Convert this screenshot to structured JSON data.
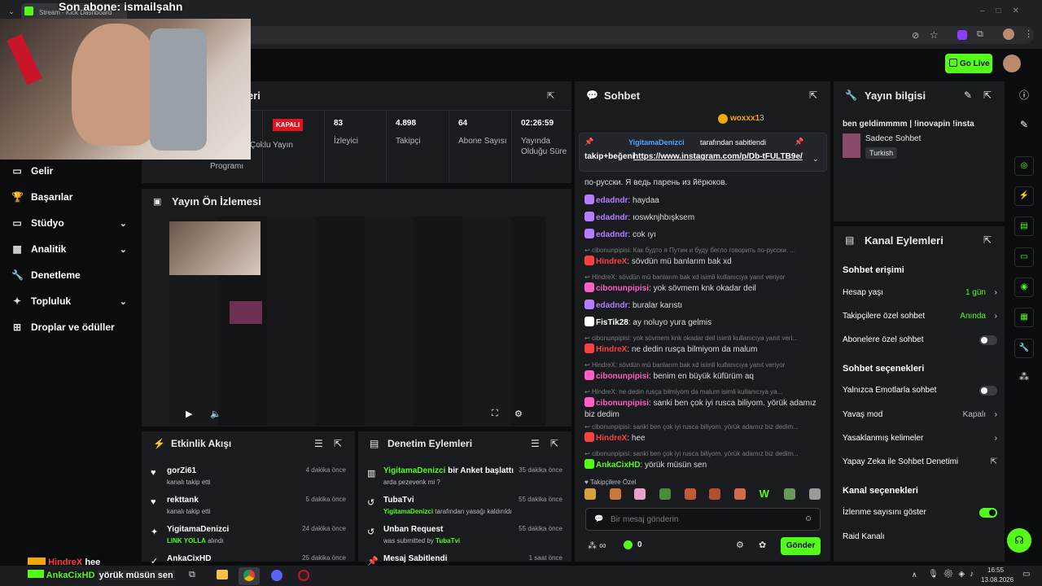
{
  "overlay": {
    "subscriber_banner": "Son abone: ismailşahn"
  },
  "browser": {
    "tab_title": "Stream - Kick Dashboard"
  },
  "header": {
    "go_live_label": "Go Live"
  },
  "nav": {
    "items": [
      {
        "label": "Gelir",
        "icon": "money-icon"
      },
      {
        "label": "Başarılar",
        "icon": "trophy-icon"
      },
      {
        "label": "Stüdyo",
        "icon": "studio-icon",
        "expandable": true
      },
      {
        "label": "Analitik",
        "icon": "chart-icon",
        "expandable": true
      },
      {
        "label": "Denetleme",
        "icon": "wrench-icon"
      },
      {
        "label": "Topluluk",
        "icon": "community-icon",
        "expandable": true
      },
      {
        "label": "Droplar ve ödüller",
        "icon": "gift-icon"
      }
    ]
  },
  "stats_panel": {
    "title_partial": "eri",
    "program_label": "Programı",
    "status_badge": "KAPALI",
    "multistream_label": "Çoklu Yayın",
    "stats": [
      {
        "value": "83",
        "label": "İzleyici"
      },
      {
        "value": "4.898",
        "label": "Takipçi"
      },
      {
        "value": "64",
        "label": "Abone Sayısı"
      },
      {
        "value": "02:26:59",
        "label": "Yayında Olduğu Süre"
      }
    ]
  },
  "preview": {
    "title": "Yayın Ön İzlemesi"
  },
  "activity_feed": {
    "title": "Etkinlik Akışı",
    "items": [
      {
        "name": "gorZi61",
        "detail": "kanalı takip etti",
        "time": "4 dakika önce"
      },
      {
        "name": "rekttank",
        "detail": "kanalı takip etti",
        "time": "5 dakika önce"
      },
      {
        "name": "YigitamaDenizci",
        "detail_highlight": "LINK YOLLA",
        "detail": "alındı",
        "time": "24 dakika önce"
      },
      {
        "name": "AnkaCixHD",
        "detail": "",
        "time": "25 dakika önce"
      }
    ]
  },
  "mod_actions": {
    "title": "Denetim Eylemleri",
    "items": [
      {
        "name": "YigitamaDenizci",
        "action": "bir Anket başlattı",
        "detail": "arda pezevenk mi ?",
        "time": "35 dakika önce"
      },
      {
        "name": "TubaTvi",
        "detail_user": "YigitamaDenizci",
        "detail": "tarafından yasağı kaldırıldı",
        "time": "55 dakika önce"
      },
      {
        "name": "Unban Request",
        "detail": "was submitted by",
        "detail_user": "TubaTvi",
        "time": "55 dakika önce"
      },
      {
        "name": "Mesaj Sabitlendi",
        "detail": "",
        "time": "1 saat önce"
      }
    ]
  },
  "chat": {
    "title": "Sohbet",
    "top_gifter": {
      "name": "woxxx1",
      "count": "3"
    },
    "pinned": {
      "by": "YigitamaDenizci",
      "by_suffix": "tarafından sabitlendi",
      "text_prefix": "takip+beğeni",
      "link": "https://www.instagram.com/p/Db-tFULTB9e/"
    },
    "overflow_text": "по-русски. Я ведь парень из йёрюков.",
    "messages": [
      {
        "user": "edadndr",
        "text": "haydaa",
        "color": "#b67dff"
      },
      {
        "user": "edadndr",
        "text": "ıoswknjhbışksem",
        "color": "#b67dff"
      },
      {
        "user": "edadndr",
        "text": "cok ıyı",
        "color": "#b67dff"
      },
      {
        "reply": "cibonunpipisi: Как будто я Путин и буду бегло говорить по-русски. ..."
      },
      {
        "user": "HindreX",
        "text": "sövdün mü banlarım bak xd",
        "color": "#ff4040"
      },
      {
        "reply": "HindreX: sövdün mü banlarım bak xd isimli kullanıcıya yanıt veriyor"
      },
      {
        "user": "cibonunpipisi",
        "text": "yok sövmem knk okadar deil",
        "color": "#ff5ec4"
      },
      {
        "user": "edadndr",
        "text": "buralar karıstı",
        "color": "#b67dff"
      },
      {
        "user": "FisTik28",
        "text": "ay noluyo yura gelmis",
        "color": "#ffffff"
      },
      {
        "reply": "cibonunpipisi: yok sövmem knk okadar deil isimli kullanıcıya yanıt veri..."
      },
      {
        "user": "HindreX",
        "text": "ne dedin rusça bilmiyom da malum",
        "color": "#ff4040"
      },
      {
        "reply": "HindreX: sövdün mü banlarım bak xd isimli kullanıcıya yanıt veriyor"
      },
      {
        "user": "cibonunpipisi",
        "text": "benim en büyük küfürüm aq",
        "color": "#ff5ec4"
      },
      {
        "reply": "HindreX: ne dedin rusça bilmiyom da malum isimli kullanıcıya ya..."
      },
      {
        "user": "cibonunpipisi",
        "text": "sanki ben çok iyi rusca biliyom. yörük adamız biz dedim",
        "color": "#ff5ec4"
      },
      {
        "reply": "cibonunpipisi: sanki ben çok iyi rusca biliyom. yörük adamız biz dedim..."
      },
      {
        "user": "HindreX",
        "text": "hee",
        "color": "#ff4040"
      },
      {
        "reply": "cibonunpipisi: sanki ben çok iyi rusca biliyom. yörük adamız biz dedim..."
      },
      {
        "user": "AnkaCixHD",
        "text": "yörük müsün sen",
        "color": "#53fc18"
      }
    ],
    "emote_label": "Takipçilere Özel",
    "input_placeholder": "Bir mesaj gönderin",
    "viewer_count": "∞",
    "points": "0",
    "send_label": "Gönder"
  },
  "stream_info": {
    "title": "Yayın bilgisi",
    "stream_title": "ben geldimmmm | !inovapin !insta",
    "category": "Sadece Sohbet",
    "language_tag": "Turkish"
  },
  "channel_actions": {
    "title": "Kanal Eylemleri",
    "chat_access_heading": "Sohbet erişimi",
    "account_age_label": "Hesap yaşı",
    "account_age_value": "1 gün",
    "followers_only_label": "Takipçilere özel sohbet",
    "followers_only_value": "Anında",
    "subs_only_label": "Abonelere özel sohbet",
    "chat_options_heading": "Sohbet seçenekleri",
    "emote_only_label": "Yalnızca Emotlarla sohbet",
    "slow_mode_label": "Yavaş mod",
    "slow_mode_value": "Kapalı",
    "banned_words_label": "Yasaklanmış kelimeler",
    "ai_mod_label": "Yapay Zeka ile Sohbet Denetimi",
    "channel_options_heading": "Kanal seçenekleri",
    "show_viewers_label": "İzlenme sayısını göster",
    "raid_label": "Raid Kanalı"
  },
  "bottom_overlay": {
    "line1_user": "HindreX",
    "line1_text": "hee",
    "line2_user": "AnkaCixHD",
    "line2_text": "yörük müsün sen"
  },
  "taskbar": {
    "time": "16:55",
    "date": "13.08.2026"
  },
  "colors": {
    "accent": "#53fc18",
    "panel": "#191b1f",
    "background": "#0b0c0d"
  }
}
